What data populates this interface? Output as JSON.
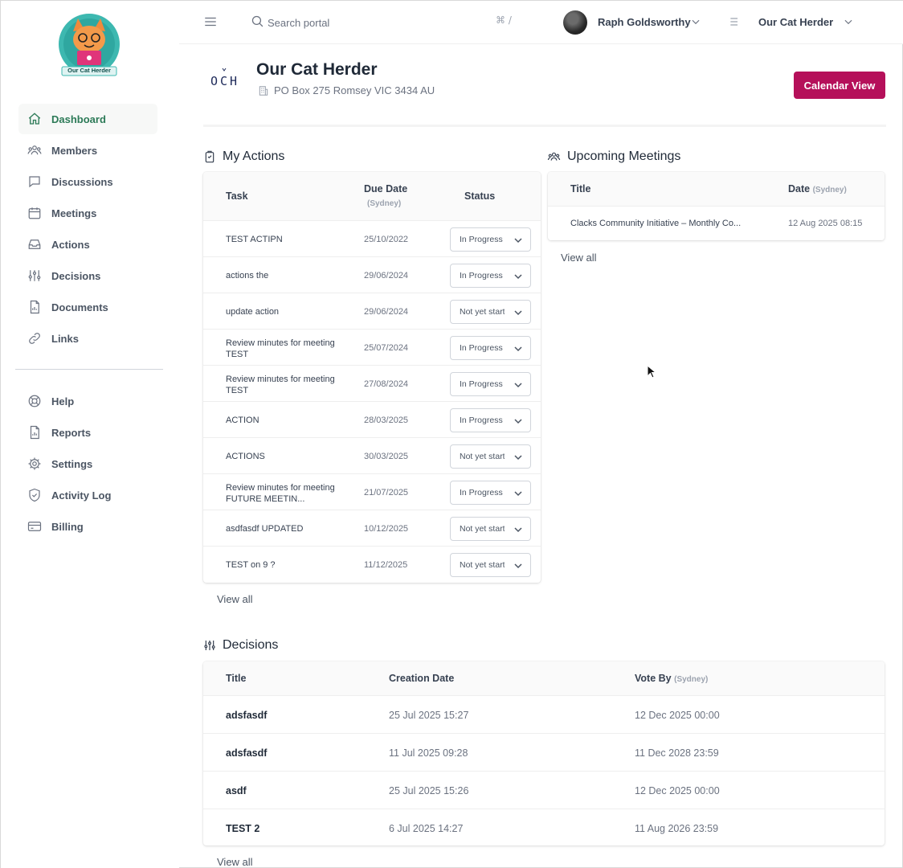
{
  "sidebar": {
    "logo_text": "Our Cat Herder",
    "items": [
      {
        "label": "Dashboard",
        "icon": "home-icon"
      },
      {
        "label": "Members",
        "icon": "users-icon"
      },
      {
        "label": "Discussions",
        "icon": "chat-icon"
      },
      {
        "label": "Meetings",
        "icon": "calendar-icon"
      },
      {
        "label": "Actions",
        "icon": "inbox-icon"
      },
      {
        "label": "Decisions",
        "icon": "sliders-icon"
      },
      {
        "label": "Documents",
        "icon": "document-icon"
      },
      {
        "label": "Links",
        "icon": "link-icon"
      }
    ],
    "secondary": [
      {
        "label": "Help",
        "icon": "lifebuoy-icon"
      },
      {
        "label": "Reports",
        "icon": "report-icon"
      },
      {
        "label": "Settings",
        "icon": "gear-icon"
      },
      {
        "label": "Activity Log",
        "icon": "shield-icon"
      },
      {
        "label": "Billing",
        "icon": "credit-card-icon"
      }
    ],
    "active": "Dashboard",
    "active_color": "#2c7a57"
  },
  "topbar": {
    "search_placeholder": "Search portal",
    "shortcut": "⌘ /",
    "user_name": "Raph Goldsworthy",
    "org_name": "Our Cat Herder"
  },
  "header": {
    "logo_text": "OCH",
    "title": "Our Cat Herder",
    "address": "PO Box 275 Romsey VIC 3434 AU",
    "calendar_button": "Calendar View",
    "accent_color": "#b5105a"
  },
  "actions": {
    "title": "My Actions",
    "columns": {
      "task": "Task",
      "due": "Due Date",
      "due_tz": "(Sydney)",
      "status": "Status"
    },
    "rows": [
      {
        "task": "TEST ACTIPN",
        "due": "25/10/2022",
        "status": "In Progress"
      },
      {
        "task": "actions the",
        "due": "29/06/2024",
        "status": "In Progress"
      },
      {
        "task": "update action",
        "due": "29/06/2024",
        "status": "Not yet started"
      },
      {
        "task": "Review minutes for meeting TEST",
        "due": "25/07/2024",
        "status": "In Progress"
      },
      {
        "task": "Review minutes for meeting TEST",
        "due": "27/08/2024",
        "status": "In Progress"
      },
      {
        "task": "ACTION",
        "due": "28/03/2025",
        "status": "In Progress"
      },
      {
        "task": "ACTIONS",
        "due": "30/03/2025",
        "status": "Not yet started"
      },
      {
        "task": "Review minutes for meeting FUTURE MEETIN...",
        "due": "21/07/2025",
        "status": "In Progress"
      },
      {
        "task": "asdfasdf UPDATED",
        "due": "10/12/2025",
        "status": "Not yet started"
      },
      {
        "task": "TEST on 9 ?",
        "due": "11/12/2025",
        "status": "Not yet started"
      }
    ],
    "view_all": "View all"
  },
  "meetings": {
    "title": "Upcoming Meetings",
    "columns": {
      "title": "Title",
      "date": "Date",
      "date_tz": "(Sydney)"
    },
    "rows": [
      {
        "title": "Clacks Community Initiative – Monthly Co...",
        "date": "12 Aug 2025 08:15"
      }
    ],
    "view_all": "View all"
  },
  "decisions": {
    "title": "Decisions",
    "columns": {
      "title": "Title",
      "created": "Creation Date",
      "vote": "Vote By",
      "vote_tz": "(Sydney)"
    },
    "rows": [
      {
        "title": "adsfasdf",
        "created": "25 Jul 2025 15:27",
        "vote": "12 Dec 2025 00:00"
      },
      {
        "title": "adsfasdf",
        "created": "11 Jul 2025 09:28",
        "vote": "11 Dec 2028 23:59"
      },
      {
        "title": "asdf",
        "created": "25 Jul 2025 15:26",
        "vote": "12 Dec 2025 00:00"
      },
      {
        "title": "TEST 2",
        "created": "6 Jul 2025 14:27",
        "vote": "11 Aug 2026 23:59"
      }
    ],
    "view_all": "View all"
  }
}
